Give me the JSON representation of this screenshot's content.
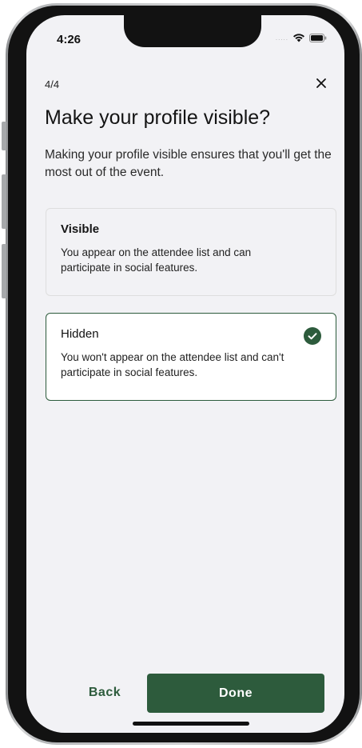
{
  "status_bar": {
    "time": "4:26",
    "signal": "....."
  },
  "header": {
    "step": "4/4",
    "title": "Make your profile visible?",
    "subtitle": "Making your profile visible ensures that you'll get the most out of the event."
  },
  "options": [
    {
      "title": "Visible",
      "description": "You appear on the attendee list and can participate in social features.",
      "selected": false
    },
    {
      "title": "Hidden",
      "description": "You won't appear on the attendee list and can't participate in social features.",
      "selected": true
    }
  ],
  "footer": {
    "back_label": "Back",
    "done_label": "Done"
  },
  "icons": {
    "close": "close-icon",
    "check": "check-circle-icon",
    "wifi": "wifi-icon",
    "battery": "battery-icon"
  },
  "colors": {
    "accent": "#2d5b3c",
    "background": "#f2f2f5"
  }
}
